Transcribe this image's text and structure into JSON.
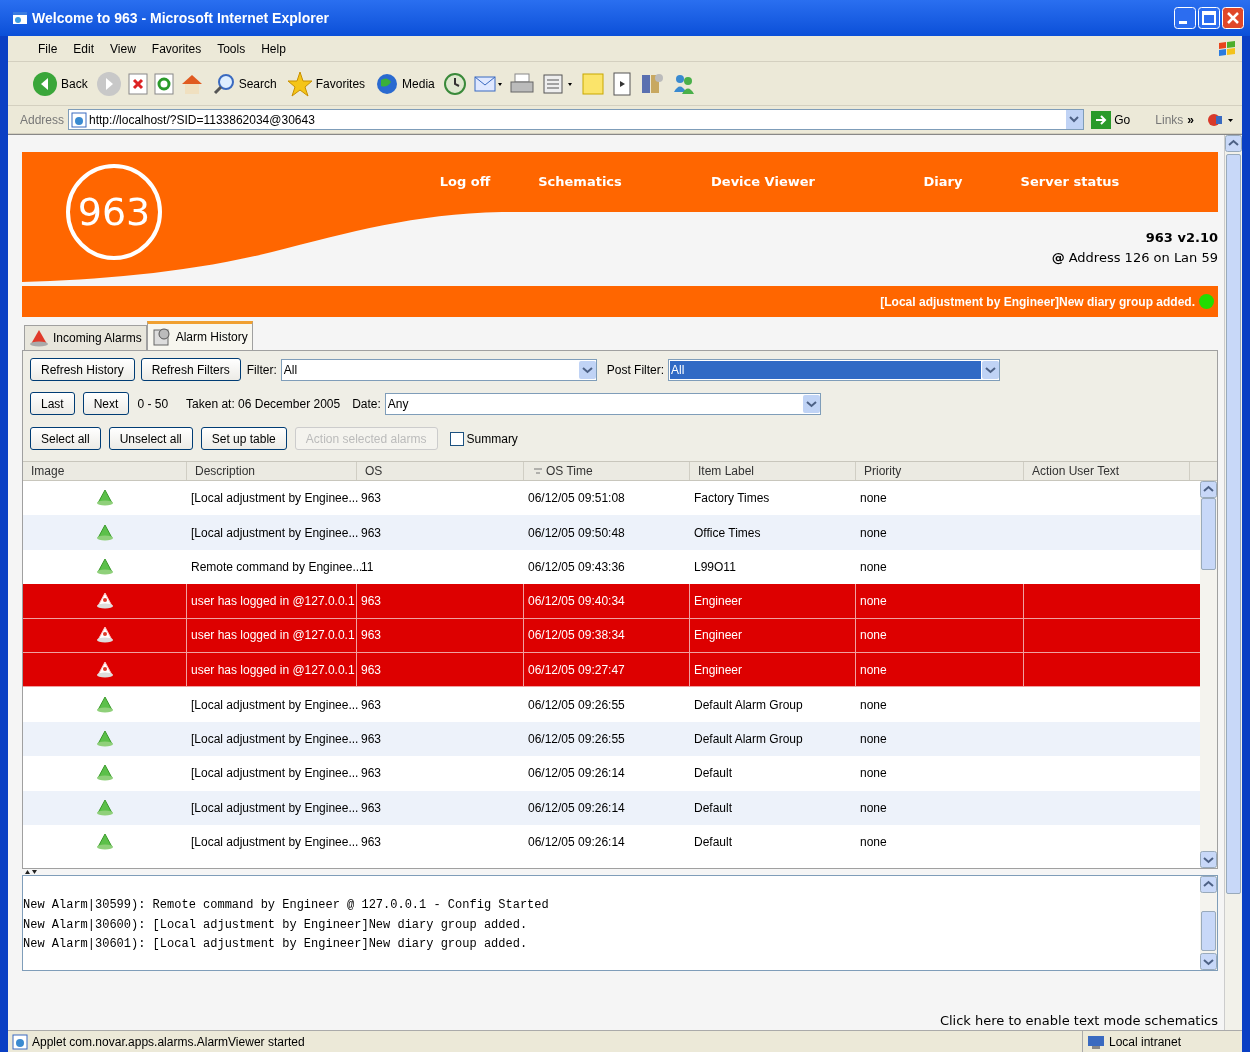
{
  "window": {
    "title": "Welcome to 963 - Microsoft Internet Explorer"
  },
  "menu": [
    "File",
    "Edit",
    "View",
    "Favorites",
    "Tools",
    "Help"
  ],
  "toolbar": [
    {
      "kind": "back",
      "label": "Back"
    },
    {
      "kind": "forward"
    },
    {
      "kind": "stop"
    },
    {
      "kind": "refresh"
    },
    {
      "kind": "home"
    },
    {
      "kind": "search",
      "label": "Search"
    },
    {
      "kind": "favorites",
      "label": "Favorites"
    },
    {
      "kind": "media",
      "label": "Media"
    },
    {
      "kind": "history"
    },
    {
      "kind": "mail"
    },
    {
      "kind": "print"
    },
    {
      "kind": "edit"
    },
    {
      "kind": "note"
    },
    {
      "kind": "messenger"
    },
    {
      "kind": "research"
    },
    {
      "kind": "people"
    }
  ],
  "address": {
    "label": "Address",
    "value": "http://localhost/?SID=1133862034@30643",
    "go": "Go",
    "links": "Links",
    "more": "»"
  },
  "header": {
    "logo": "963",
    "nav": [
      "Log off",
      "Schematics",
      "Device Viewer",
      "Diary",
      "Server status"
    ],
    "version": "963 v2.10",
    "location_icon": "@",
    "location": "Address 126 on Lan 59"
  },
  "message_bar": {
    "text": "[Local adjustment by Engineer]New diary group added.",
    "color": "#22dd00"
  },
  "tabs": [
    {
      "label": "Incoming Alarms",
      "selected": false
    },
    {
      "label": "Alarm History",
      "selected": true
    }
  ],
  "controls": {
    "refresh_history": {
      "label": "Refresh History",
      "disabled": false
    },
    "refresh_filters": {
      "label": "Refresh Filters",
      "disabled": false
    },
    "filter": {
      "label": "Filter:",
      "value": "All",
      "focused": false
    },
    "post_filter": {
      "label": "Post Filter:",
      "value": "All",
      "focused": true
    },
    "last": {
      "label": "Last",
      "disabled": false
    },
    "next": {
      "label": "Next",
      "disabled": false
    },
    "range": "0 - 50",
    "taken_at": "Taken at: 06 December 2005",
    "date": {
      "label": "Date:",
      "value": "Any",
      "focused": false
    },
    "select_all": {
      "label": "Select all",
      "disabled": false
    },
    "unselect_all": {
      "label": "Unselect all",
      "disabled": false
    },
    "set_up_table": {
      "label": "Set up table",
      "disabled": false
    },
    "action_selected": {
      "label": "Action selected alarms",
      "disabled": true
    },
    "summary": {
      "label": "Summary",
      "checked": false
    }
  },
  "table": {
    "columns": [
      "Image",
      "Description",
      "OS",
      "OS Time",
      "Item Label",
      "Priority",
      "Action User Text"
    ],
    "rows": [
      {
        "kind": "event",
        "description": "[Local adjustment by Enginee...",
        "os": "963",
        "os_time": "06/12/05 09:51:08",
        "item_label": "Factory Times",
        "priority": "none"
      },
      {
        "kind": "event",
        "description": "[Local adjustment by Enginee...",
        "os": "963",
        "os_time": "06/12/05 09:50:48",
        "item_label": "Office Times",
        "priority": "none"
      },
      {
        "kind": "event",
        "description": "Remote command by Enginee...",
        "os": "11",
        "os_time": "06/12/05 09:43:36",
        "item_label": "L99O11",
        "priority": "none"
      },
      {
        "kind": "alarm",
        "description": "user has logged in @127.0.0.1",
        "os": "963",
        "os_time": "06/12/05 09:40:34",
        "item_label": "Engineer",
        "priority": "none"
      },
      {
        "kind": "alarm",
        "description": "user has logged in @127.0.0.1",
        "os": "963",
        "os_time": "06/12/05 09:38:34",
        "item_label": "Engineer",
        "priority": "none"
      },
      {
        "kind": "alarm",
        "description": "user has logged in @127.0.0.1",
        "os": "963",
        "os_time": "06/12/05 09:27:47",
        "item_label": "Engineer",
        "priority": "none"
      },
      {
        "kind": "event",
        "description": "[Local adjustment by Enginee...",
        "os": "963",
        "os_time": "06/12/05 09:26:55",
        "item_label": "Default Alarm Group",
        "priority": "none"
      },
      {
        "kind": "event",
        "description": "[Local adjustment by Enginee...",
        "os": "963",
        "os_time": "06/12/05 09:26:55",
        "item_label": "Default Alarm Group",
        "priority": "none"
      },
      {
        "kind": "event",
        "description": "[Local adjustment by Enginee...",
        "os": "963",
        "os_time": "06/12/05 09:26:14",
        "item_label": "Default",
        "priority": "none"
      },
      {
        "kind": "event",
        "description": "[Local adjustment by Enginee...",
        "os": "963",
        "os_time": "06/12/05 09:26:14",
        "item_label": "Default",
        "priority": "none"
      },
      {
        "kind": "event",
        "description": "[Local adjustment by Enginee...",
        "os": "963",
        "os_time": "06/12/05 09:26:14",
        "item_label": "Default",
        "priority": "none"
      }
    ]
  },
  "log": [
    "New Alarm|30599): Remote command by Engineer @ 127.0.0.1 - Config Started",
    "New Alarm|30600): [Local adjustment by Engineer]New diary group added.",
    "New Alarm|30601): [Local adjustment by Engineer]New diary group added."
  ],
  "text_mode_link": "Click here to enable text mode schematics",
  "status_bar": {
    "text": "Applet com.novar.apps.alarms.AlarmViewer started",
    "zone": "Local intranet"
  }
}
